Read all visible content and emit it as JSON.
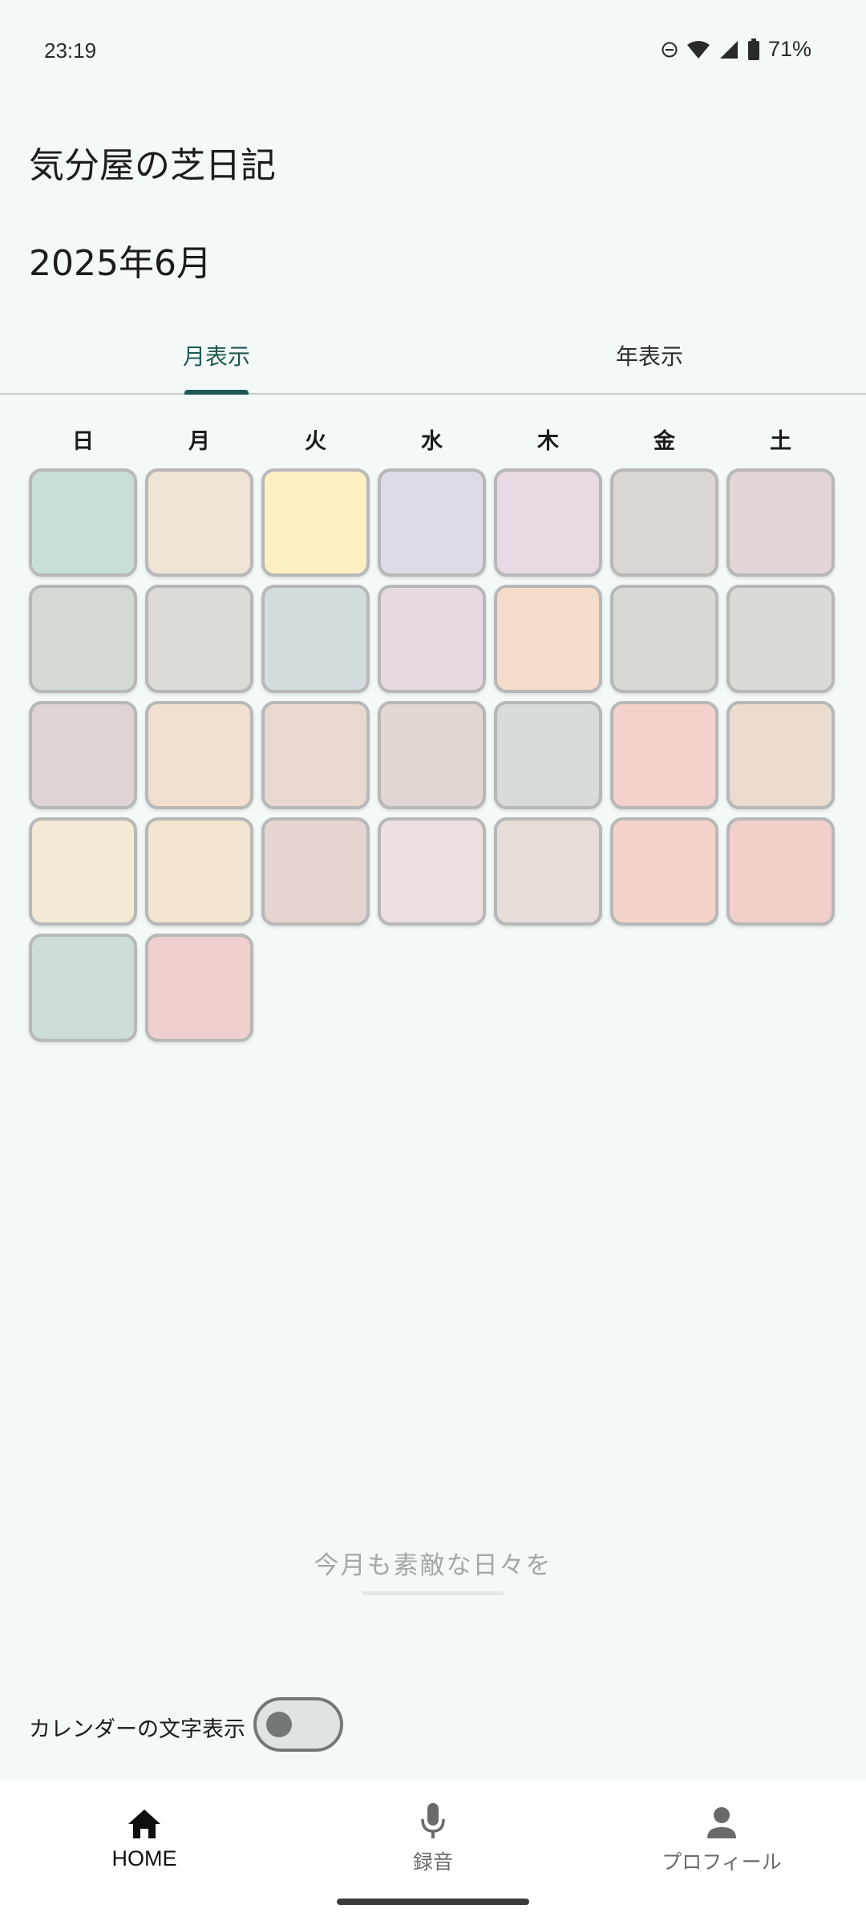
{
  "status_bar": {
    "time": "23:19",
    "battery": "71%",
    "icons": [
      "dnd-icon",
      "wifi-icon",
      "signal-icon",
      "battery-icon"
    ]
  },
  "header": {
    "app_title": "気分屋の芝日記",
    "month_title": "2025年6月"
  },
  "tabs": [
    {
      "label": "月表示",
      "active": true
    },
    {
      "label": "年表示",
      "active": false
    }
  ],
  "calendar": {
    "weekdays": [
      "日",
      "月",
      "火",
      "水",
      "木",
      "金",
      "土"
    ],
    "day_colors": [
      "#c8dfd6",
      "#efe3d3",
      "#fcefc2",
      "#dedbe6",
      "#e8d9e5",
      "#dbd6d3",
      "#e3d4d5",
      "#d3dad3",
      "#dcdbd8",
      "#d3dcdf",
      "#e6d9e4",
      "#f6dccb",
      "#d8d9d5",
      "#dcdad7",
      "#ded4d3",
      "#f1e0cf",
      "#ead9d1",
      "#e1d7d3",
      "#d7dbd9",
      "#f3d1cc",
      "#eadcd1",
      "#f3e9d5",
      "#f2e6d1",
      "#e6d4d1",
      "#ece0de",
      "#e6ddd9",
      "#f4d4ca",
      "#f2cfcb",
      "#ceddda",
      "#efd0ce"
    ]
  },
  "motto": "今月も素敵な日々を",
  "toggle": {
    "label": "カレンダーの文字表示",
    "on": false
  },
  "bottom_nav": [
    {
      "label": "HOME",
      "icon": "home-icon",
      "active": true
    },
    {
      "label": "録音",
      "icon": "mic-icon",
      "active": false
    },
    {
      "label": "プロフィール",
      "icon": "person-icon",
      "active": false
    }
  ]
}
